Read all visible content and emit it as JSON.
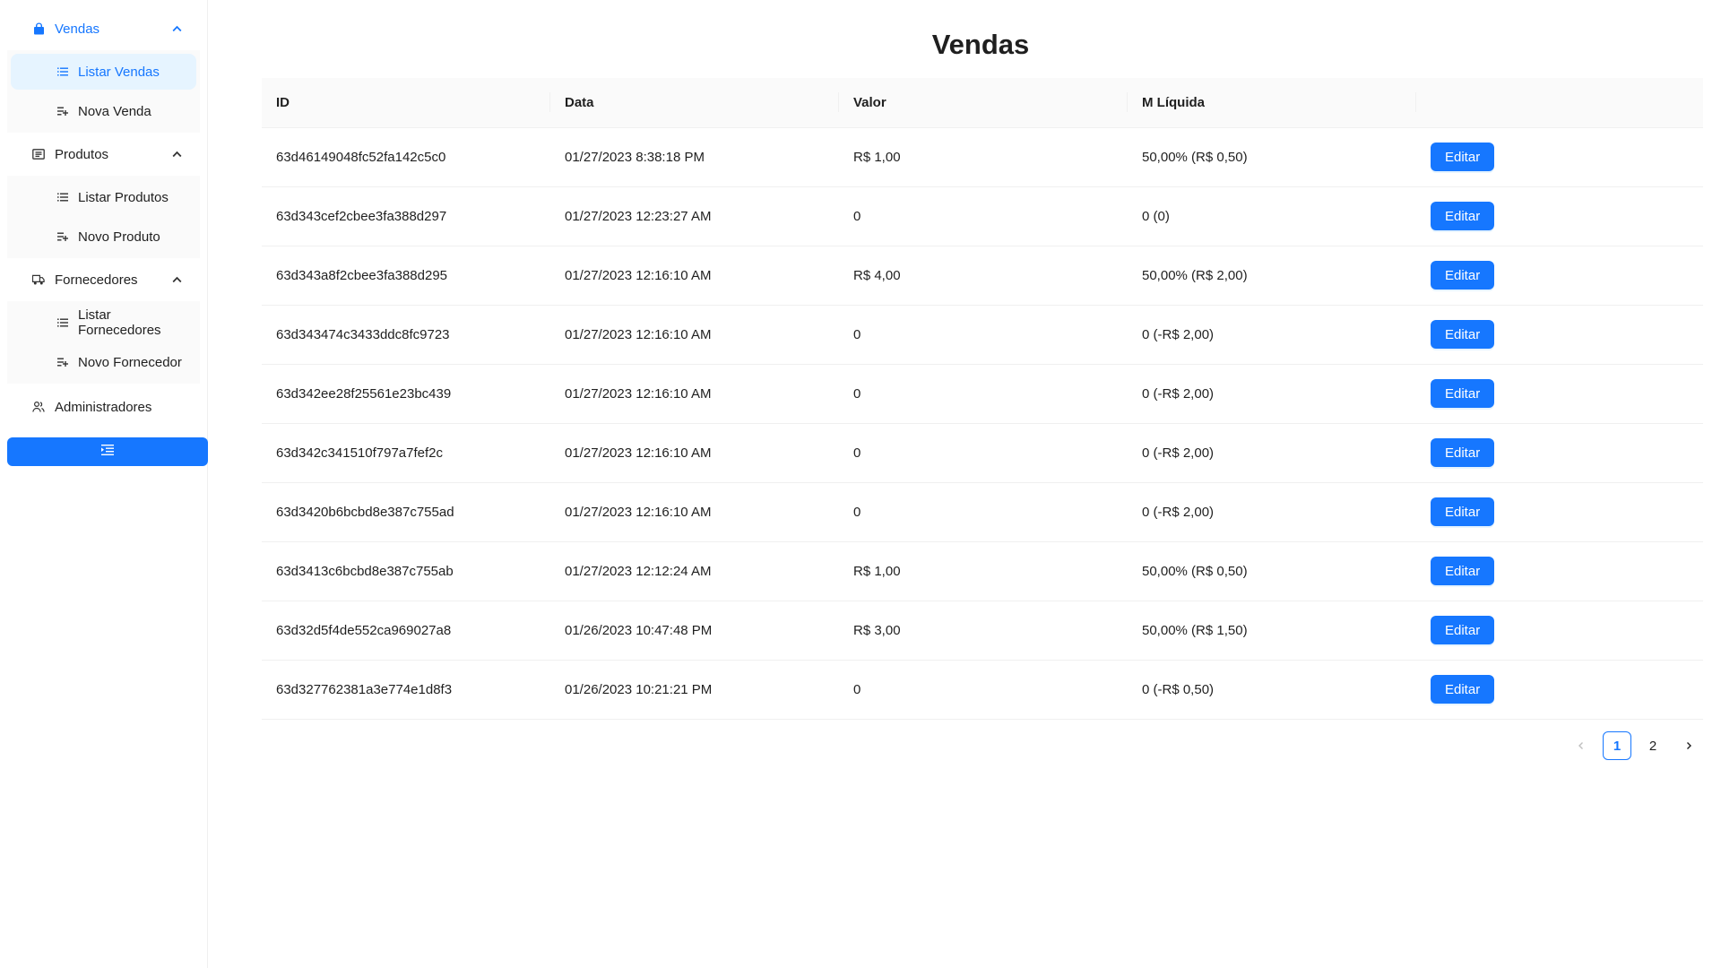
{
  "sidebar": {
    "groups": [
      {
        "label": "Vendas",
        "icon": "shopping-bag-icon",
        "expanded": true,
        "active": true,
        "items": [
          {
            "label": "Listar Vendas",
            "icon": "list-icon",
            "selected": true
          },
          {
            "label": "Nova Venda",
            "icon": "add-list-icon",
            "selected": false
          }
        ]
      },
      {
        "label": "Produtos",
        "icon": "product-icon",
        "expanded": true,
        "active": false,
        "items": [
          {
            "label": "Listar Produtos",
            "icon": "list-icon",
            "selected": false
          },
          {
            "label": "Novo Produto",
            "icon": "add-list-icon",
            "selected": false
          }
        ]
      },
      {
        "label": "Fornecedores",
        "icon": "truck-icon",
        "expanded": true,
        "active": false,
        "items": [
          {
            "label": "Listar Fornecedores",
            "icon": "list-icon",
            "selected": false
          },
          {
            "label": "Novo Fornecedor",
            "icon": "add-list-icon",
            "selected": false
          }
        ]
      }
    ],
    "admin_label": "Administradores",
    "collapse_icon": "menu-fold-icon"
  },
  "main": {
    "title": "Vendas",
    "table": {
      "columns": [
        "ID",
        "Data",
        "Valor",
        "M Líquida",
        ""
      ],
      "rows": [
        {
          "id": "63d46149048fc52fa142c5c0",
          "data": "01/27/2023 8:38:18 PM",
          "valor": "R$ 1,00",
          "margem": "50,00% (R$ 0,50)",
          "action": "Editar"
        },
        {
          "id": "63d343cef2cbee3fa388d297",
          "data": "01/27/2023 12:23:27 AM",
          "valor": "0",
          "margem": "0 (0)",
          "action": "Editar"
        },
        {
          "id": "63d343a8f2cbee3fa388d295",
          "data": "01/27/2023 12:16:10 AM",
          "valor": "R$ 4,00",
          "margem": "50,00% (R$ 2,00)",
          "action": "Editar"
        },
        {
          "id": "63d343474c3433ddc8fc9723",
          "data": "01/27/2023 12:16:10 AM",
          "valor": "0",
          "margem": "0 (-R$ 2,00)",
          "action": "Editar"
        },
        {
          "id": "63d342ee28f25561e23bc439",
          "data": "01/27/2023 12:16:10 AM",
          "valor": "0",
          "margem": "0 (-R$ 2,00)",
          "action": "Editar"
        },
        {
          "id": "63d342c341510f797a7fef2c",
          "data": "01/27/2023 12:16:10 AM",
          "valor": "0",
          "margem": "0 (-R$ 2,00)",
          "action": "Editar"
        },
        {
          "id": "63d3420b6bcbd8e387c755ad",
          "data": "01/27/2023 12:16:10 AM",
          "valor": "0",
          "margem": "0 (-R$ 2,00)",
          "action": "Editar"
        },
        {
          "id": "63d3413c6bcbd8e387c755ab",
          "data": "01/27/2023 12:12:24 AM",
          "valor": "R$ 1,00",
          "margem": "50,00% (R$ 0,50)",
          "action": "Editar"
        },
        {
          "id": "63d32d5f4de552ca969027a8",
          "data": "01/26/2023 10:47:48 PM",
          "valor": "R$ 3,00",
          "margem": "50,00% (R$ 1,50)",
          "action": "Editar"
        },
        {
          "id": "63d327762381a3e774e1d8f3",
          "data": "01/26/2023 10:21:21 PM",
          "valor": "0",
          "margem": "0 (-R$ 0,50)",
          "action": "Editar"
        }
      ]
    },
    "pagination": {
      "prev_icon": "chevron-left-icon",
      "pages": [
        "1",
        "2"
      ],
      "current": "1",
      "next_icon": "chevron-right-icon"
    }
  },
  "colors": {
    "primary": "#1677ff",
    "selected_bg": "#e6f4ff",
    "submenu_bg": "#fafafa",
    "border": "#f0f0f0"
  }
}
